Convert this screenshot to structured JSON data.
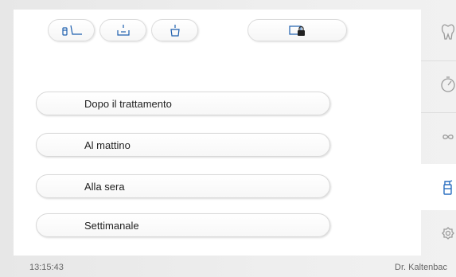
{
  "toolbar": {
    "buttons": [
      {
        "icon": "spray-chair-icon"
      },
      {
        "icon": "basin-icon"
      },
      {
        "icon": "cup-icon"
      },
      {
        "icon": "lock-icon"
      }
    ]
  },
  "programs": [
    {
      "label": "Dopo il trattamento"
    },
    {
      "label": "Al mattino"
    },
    {
      "label": "Alla sera"
    },
    {
      "label": "Settimanale"
    }
  ],
  "sidebar": {
    "tabs": [
      {
        "icon": "tooth-icon",
        "active": false
      },
      {
        "icon": "timer-icon",
        "active": false
      },
      {
        "icon": "infinity-icon",
        "active": false
      },
      {
        "icon": "spray-bottle-icon",
        "active": true
      },
      {
        "icon": "settings-icon",
        "active": false
      }
    ]
  },
  "status_bar": {
    "time": "13:15:43",
    "user": "Dr. Kaltenbac"
  },
  "colors": {
    "accent": "#2a6fc0",
    "icon_gray": "#9a9a9a"
  }
}
